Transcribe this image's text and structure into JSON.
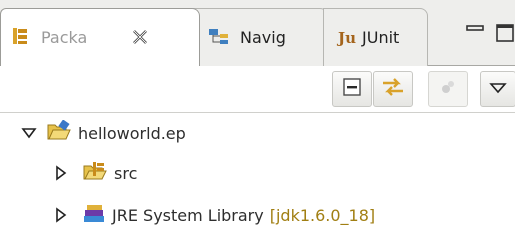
{
  "tabs": [
    {
      "label": "Packa",
      "active": true,
      "icon": "package-explorer-icon",
      "close_glyph": "close-icon"
    },
    {
      "label": "Navig",
      "active": false,
      "icon": "navigator-icon"
    },
    {
      "label": "JUnit",
      "active": false,
      "icon": "junit-icon",
      "icon_text": "Ju"
    }
  ],
  "window_controls": [
    "minimize-icon",
    "maximize-icon"
  ],
  "toolbar": {
    "buttons": [
      "collapse-all-icon",
      "link-with-editor-icon",
      "focus-icon",
      "view-menu-chevron-icon"
    ]
  },
  "tree": {
    "root": {
      "label": "helloworld.ep",
      "expanded": true,
      "icon": "project-folder-icon"
    },
    "children": [
      {
        "label": "src",
        "expanded": false,
        "icon": "source-folder-icon"
      },
      {
        "label": "JRE System Library",
        "decoration": "[jdk1.6.0_18]",
        "expanded": false,
        "icon": "library-icon"
      }
    ]
  },
  "colors": {
    "tab_bar_bg": "#eeeeec",
    "decoration": "#a17f13",
    "folder": "#e7c24a",
    "inactive_label": "#9a9a9a"
  }
}
